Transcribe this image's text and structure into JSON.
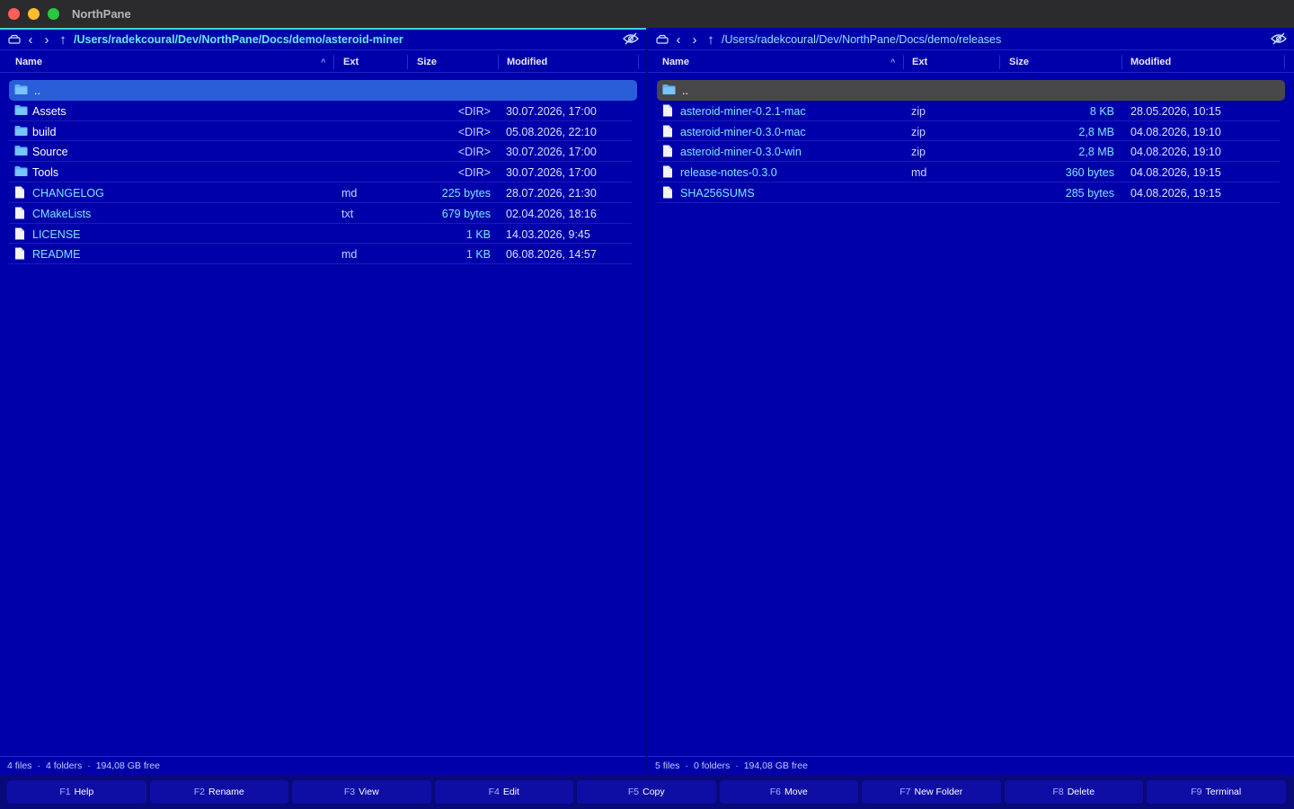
{
  "app": {
    "title": "NorthPane"
  },
  "colors": {
    "pane_bg": "#0000aa",
    "active_border": "#3dd1d1",
    "selection_active": "#2a5ed8",
    "selection_inactive": "#48484a",
    "file_text": "#7fe3ff"
  },
  "left": {
    "path": "/Users/radekcoural/Dev/NorthPane/Docs/demo/asteroid-miner",
    "columns": {
      "name": "Name",
      "ext": "Ext",
      "size": "Size",
      "modified": "Modified"
    },
    "parent": {
      "name": ".."
    },
    "rows": [
      {
        "name": "Assets",
        "ext": "",
        "size": "<DIR>",
        "modified": "30.07.2026, 17:00"
      },
      {
        "name": "build",
        "ext": "",
        "size": "<DIR>",
        "modified": "05.08.2026, 22:10"
      },
      {
        "name": "Source",
        "ext": "",
        "size": "<DIR>",
        "modified": "30.07.2026, 17:00"
      },
      {
        "name": "Tools",
        "ext": "",
        "size": "<DIR>",
        "modified": "30.07.2026, 17:00"
      },
      {
        "name": "CHANGELOG",
        "ext": "md",
        "size": "225 bytes",
        "modified": "28.07.2026, 21:30"
      },
      {
        "name": "CMakeLists",
        "ext": "txt",
        "size": "679 bytes",
        "modified": "02.04.2026, 18:16"
      },
      {
        "name": "LICENSE",
        "ext": "",
        "size": "1 KB",
        "modified": "14.03.2026, 9:45"
      },
      {
        "name": "README",
        "ext": "md",
        "size": "1 KB",
        "modified": "06.08.2026, 14:57"
      }
    ],
    "status": {
      "files": "4 files",
      "folders": "4 folders",
      "free": "194,08 GB free",
      "dot": "·"
    }
  },
  "right": {
    "path": "/Users/radekcoural/Dev/NorthPane/Docs/demo/releases",
    "columns": {
      "name": "Name",
      "ext": "Ext",
      "size": "Size",
      "modified": "Modified"
    },
    "parent": {
      "name": ".."
    },
    "rows": [
      {
        "name": "asteroid-miner-0.2.1-mac",
        "ext": "zip",
        "size": "8 KB",
        "modified": "28.05.2026, 10:15"
      },
      {
        "name": "asteroid-miner-0.3.0-mac",
        "ext": "zip",
        "size": "2,8 MB",
        "modified": "04.08.2026, 19:10"
      },
      {
        "name": "asteroid-miner-0.3.0-win",
        "ext": "zip",
        "size": "2,8 MB",
        "modified": "04.08.2026, 19:10"
      },
      {
        "name": "release-notes-0.3.0",
        "ext": "md",
        "size": "360 bytes",
        "modified": "04.08.2026, 19:15"
      },
      {
        "name": "SHA256SUMS",
        "ext": "",
        "size": "285 bytes",
        "modified": "04.08.2026, 19:15"
      }
    ],
    "status": {
      "files": "5 files",
      "folders": "0 folders",
      "free": "194,08 GB free",
      "dot": "·"
    }
  },
  "fkeys": [
    {
      "key": "F1",
      "label": "Help"
    },
    {
      "key": "F2",
      "label": "Rename"
    },
    {
      "key": "F3",
      "label": "View"
    },
    {
      "key": "F4",
      "label": "Edit"
    },
    {
      "key": "F5",
      "label": "Copy"
    },
    {
      "key": "F6",
      "label": "Move"
    },
    {
      "key": "F7",
      "label": "New Folder"
    },
    {
      "key": "F8",
      "label": "Delete"
    },
    {
      "key": "F9",
      "label": "Terminal"
    }
  ]
}
